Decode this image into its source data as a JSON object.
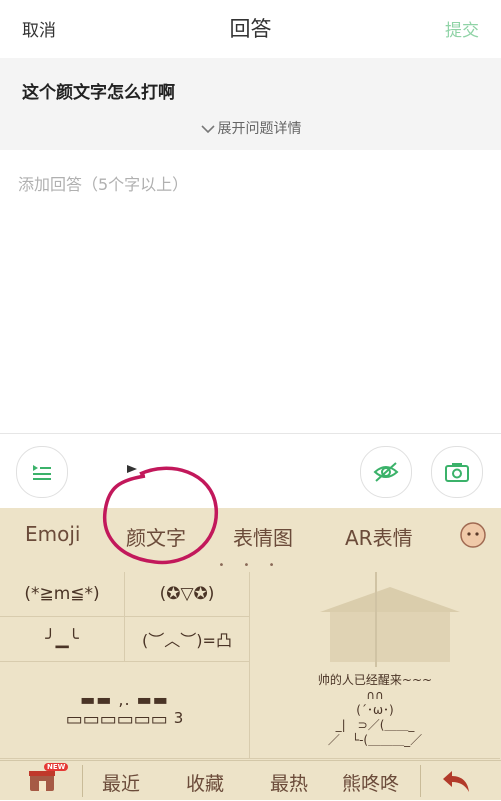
{
  "header": {
    "cancel": "取消",
    "title": "回答",
    "submit": "提交"
  },
  "question": {
    "title": "这个颜文字怎么打啊",
    "expand": "展开问题详情"
  },
  "answer": {
    "placeholder": "添加回答（5个字以上）"
  },
  "tools": {
    "left": "list-icon",
    "eye": "eye-off-icon",
    "camera": "camera-icon"
  },
  "keyboard": {
    "tabs": [
      "Emoji",
      "颜文字",
      "表情图",
      "AR表情"
    ],
    "selected_tab": "颜文字",
    "page_dots": "• • •",
    "cells": {
      "c1": "(*≧m≦*)",
      "c2": "(✪▽✪)",
      "c3": "╯▁╰",
      "c4": "(︶︿︶)=凸",
      "c5_line1": "▬▬ ,. ▬▬",
      "c5_line2": "▭▭▭▭▭▭",
      "c5_sup": "3",
      "c6_line1": "帅的人已经醒来~~~",
      "c6_line2": "∩∩",
      "c6_line3": "(´･ω･)",
      "c6_line4": "_|　⊃／(＿＿_",
      "c6_line5": "／　└-(＿＿＿_／"
    },
    "bottom": {
      "recent": "最近",
      "favorites": "收藏",
      "hottest": "最热",
      "bear": "熊咚咚",
      "new_badge": "NEW"
    },
    "colors": {
      "selected_tab_ring": "#c2185b",
      "accent_green": "#3bb26a"
    }
  }
}
